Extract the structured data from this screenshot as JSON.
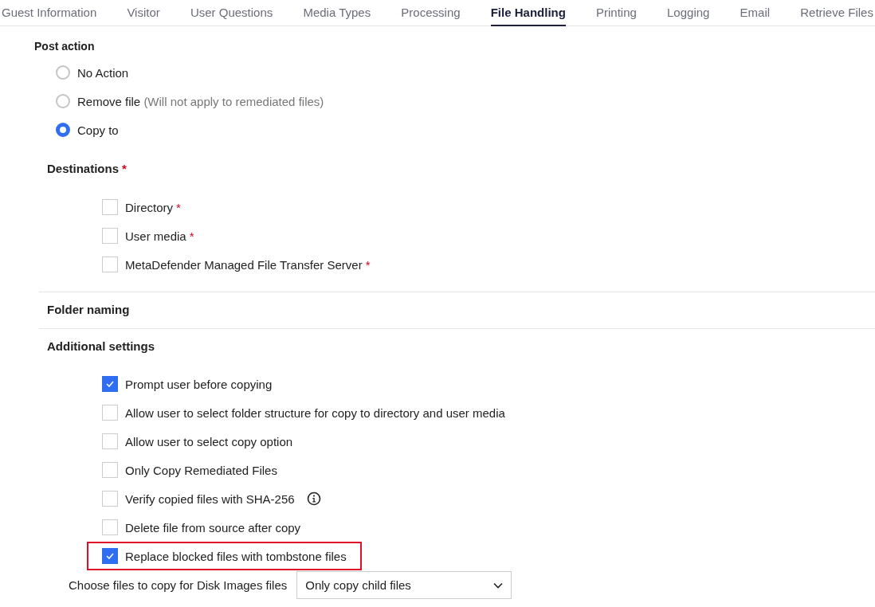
{
  "tabs": [
    {
      "label": "Guest Information",
      "selected": false
    },
    {
      "label": "Visitor",
      "selected": false
    },
    {
      "label": "User Questions",
      "selected": false
    },
    {
      "label": "Media Types",
      "selected": false
    },
    {
      "label": "Processing",
      "selected": false
    },
    {
      "label": "File Handling",
      "selected": true
    },
    {
      "label": "Printing",
      "selected": false
    },
    {
      "label": "Logging",
      "selected": false
    },
    {
      "label": "Email",
      "selected": false
    },
    {
      "label": "Retrieve Files",
      "selected": false
    }
  ],
  "post_action": {
    "title": "Post action",
    "options": [
      {
        "label": "No Action",
        "selected": false
      },
      {
        "label": "Remove file",
        "note": "(Will not apply to remediated files)",
        "selected": false
      },
      {
        "label": "Copy to",
        "selected": true
      }
    ]
  },
  "destinations": {
    "title": "Destinations",
    "required_mark": "*",
    "items": [
      {
        "label": "Directory",
        "required_mark": "*",
        "checked": false
      },
      {
        "label": "User media",
        "required_mark": "*",
        "checked": false
      },
      {
        "label": "MetaDefender Managed File Transfer Server",
        "required_mark": "*",
        "checked": false
      }
    ]
  },
  "folder_naming": {
    "title": "Folder naming"
  },
  "additional_settings": {
    "title": "Additional settings",
    "items": [
      {
        "label": "Prompt user before copying",
        "checked": true,
        "info": false,
        "highlighted": false
      },
      {
        "label": "Allow user to select folder structure for copy to directory and user media",
        "checked": false,
        "info": false,
        "highlighted": false
      },
      {
        "label": "Allow user to select copy option",
        "checked": false,
        "info": false,
        "highlighted": false
      },
      {
        "label": "Only Copy Remediated Files",
        "checked": false,
        "info": false,
        "highlighted": false
      },
      {
        "label": "Verify copied files with SHA-256",
        "checked": false,
        "info": true,
        "highlighted": false
      },
      {
        "label": "Delete file from source after copy",
        "checked": false,
        "info": false,
        "highlighted": false
      },
      {
        "label": "Replace blocked files with tombstone files",
        "checked": true,
        "info": false,
        "highlighted": true
      }
    ]
  },
  "disk_images": {
    "label": "Choose files to copy for Disk Images files",
    "value": "Only copy child files"
  }
}
